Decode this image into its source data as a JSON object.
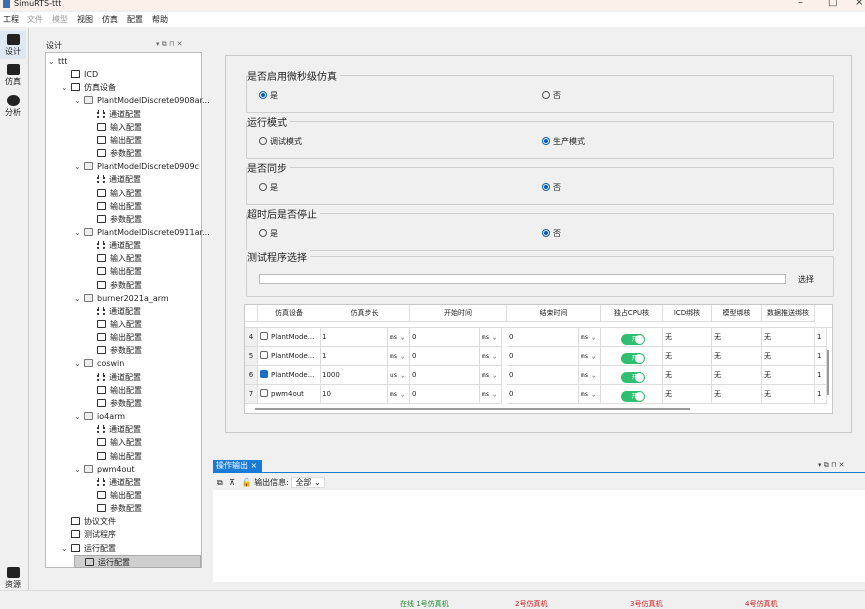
{
  "window": {
    "title": "SimuRTS-ttt"
  },
  "menu": [
    "工程",
    "文件",
    "模型",
    "视图",
    "仿真",
    "配置",
    "帮助"
  ],
  "sidebar": {
    "items": [
      "设计",
      "仿真",
      "分析"
    ],
    "bottom": "资源"
  },
  "tree_panel": {
    "title": "设计",
    "rows": [
      {
        "l": 0,
        "exp": true,
        "icon": "none",
        "label": "ttt"
      },
      {
        "l": 1,
        "icon": "folder",
        "label": "ICD"
      },
      {
        "l": 1,
        "exp": true,
        "icon": "folder",
        "label": "仿真设备"
      },
      {
        "l": 2,
        "exp": true,
        "icon": "device",
        "label": "PlantModelDiscrete0908ar..."
      },
      {
        "l": 3,
        "icon": "bars",
        "label": "通道配置"
      },
      {
        "l": 3,
        "icon": "input",
        "label": "输入配置"
      },
      {
        "l": 3,
        "icon": "output",
        "label": "输出配置"
      },
      {
        "l": 3,
        "icon": "param",
        "label": "参数配置"
      },
      {
        "l": 2,
        "exp": true,
        "icon": "device",
        "label": "PlantModelDiscrete0909c"
      },
      {
        "l": 3,
        "icon": "bars",
        "label": "通道配置"
      },
      {
        "l": 3,
        "icon": "input",
        "label": "输入配置"
      },
      {
        "l": 3,
        "icon": "output",
        "label": "输出配置"
      },
      {
        "l": 3,
        "icon": "param",
        "label": "参数配置"
      },
      {
        "l": 2,
        "exp": true,
        "icon": "device",
        "label": "PlantModelDiscrete0911ar..."
      },
      {
        "l": 3,
        "icon": "bars",
        "label": "通道配置"
      },
      {
        "l": 3,
        "icon": "input",
        "label": "输入配置"
      },
      {
        "l": 3,
        "icon": "output",
        "label": "输出配置"
      },
      {
        "l": 3,
        "icon": "param",
        "label": "参数配置"
      },
      {
        "l": 2,
        "exp": true,
        "icon": "device",
        "label": "burner2021a_arm"
      },
      {
        "l": 3,
        "icon": "bars",
        "label": "通道配置"
      },
      {
        "l": 3,
        "icon": "input",
        "label": "输入配置"
      },
      {
        "l": 3,
        "icon": "output",
        "label": "输出配置"
      },
      {
        "l": 3,
        "icon": "param",
        "label": "参数配置"
      },
      {
        "l": 2,
        "exp": true,
        "icon": "device",
        "label": "coswin"
      },
      {
        "l": 3,
        "icon": "bars",
        "label": "通道配置"
      },
      {
        "l": 3,
        "icon": "output",
        "label": "输出配置"
      },
      {
        "l": 3,
        "icon": "param",
        "label": "参数配置"
      },
      {
        "l": 2,
        "exp": true,
        "icon": "device",
        "label": "io4arm"
      },
      {
        "l": 3,
        "icon": "bars",
        "label": "通道配置"
      },
      {
        "l": 3,
        "icon": "input",
        "label": "输入配置"
      },
      {
        "l": 3,
        "icon": "output",
        "label": "输出配置"
      },
      {
        "l": 2,
        "exp": true,
        "icon": "device",
        "label": "pwm4out"
      },
      {
        "l": 3,
        "icon": "bars",
        "label": "通道配置"
      },
      {
        "l": 3,
        "icon": "output",
        "label": "输出配置"
      },
      {
        "l": 3,
        "icon": "param",
        "label": "参数配置"
      },
      {
        "l": 1,
        "icon": "folder",
        "label": "协议文件"
      },
      {
        "l": 1,
        "icon": "folder",
        "label": "测试程序"
      },
      {
        "l": 1,
        "exp": true,
        "icon": "folder",
        "label": "运行配置"
      },
      {
        "l": 2,
        "icon": "param",
        "label": "运行配置",
        "selected": true
      }
    ]
  },
  "settings": {
    "groups": [
      {
        "title": "是否启用微秒级仿真",
        "options": [
          "是",
          "否"
        ],
        "selected": 0
      },
      {
        "title": "运行模式",
        "options": [
          "调试模式",
          "生产模式"
        ],
        "selected": 1
      },
      {
        "title": "是否同步",
        "options": [
          "是",
          "否"
        ],
        "selected": 1
      },
      {
        "title": "超时后是否停止",
        "options": [
          "是",
          "否"
        ],
        "selected": 1
      }
    ],
    "test_program": {
      "title": "测试程序选择",
      "select_label": "选择"
    }
  },
  "table": {
    "headers": [
      "仿真设备",
      "仿真步长",
      "开始时间",
      "结束时间",
      "独占CPU核",
      "ICD绑核",
      "模型绑核",
      "数据推送绑核"
    ],
    "rows": [
      {
        "n": "4",
        "checked": false,
        "device": "PlantMode...",
        "step": "1",
        "step_unit": "ms",
        "start": "0",
        "start_unit": "ms",
        "end": "0",
        "end_unit": "ms",
        "cpu": "开",
        "icd": "无",
        "model": "无",
        "push": "无",
        "extra": "1"
      },
      {
        "n": "5",
        "checked": false,
        "device": "PlantMode...",
        "step": "1",
        "step_unit": "ms",
        "start": "0",
        "start_unit": "ms",
        "end": "0",
        "end_unit": "ms",
        "cpu": "开",
        "icd": "无",
        "model": "无",
        "push": "无",
        "extra": "1"
      },
      {
        "n": "6",
        "checked": true,
        "device": "PlantMode...",
        "step": "1000",
        "step_unit": "us",
        "start": "0",
        "start_unit": "ms",
        "end": "0",
        "end_unit": "ms",
        "cpu": "开",
        "icd": "无",
        "model": "无",
        "push": "无",
        "extra": "1"
      },
      {
        "n": "7",
        "checked": false,
        "device": "pwm4out",
        "step": "10",
        "step_unit": "ms",
        "start": "0",
        "start_unit": "ms",
        "end": "0",
        "end_unit": "ms",
        "cpu": "开",
        "icd": "无",
        "model": "无",
        "push": "无",
        "extra": "1"
      }
    ]
  },
  "output": {
    "tab": "操作输出",
    "filter_label": "输出信息:",
    "filter_value": "全部"
  },
  "status": [
    {
      "text": "在线 1号仿真机",
      "color": "#1a8a2a"
    },
    {
      "text": "2号仿真机",
      "color": "#d01818"
    },
    {
      "text": "3号仿真机",
      "color": "#d01818"
    },
    {
      "text": "4号仿真机",
      "color": "#d01818"
    }
  ]
}
